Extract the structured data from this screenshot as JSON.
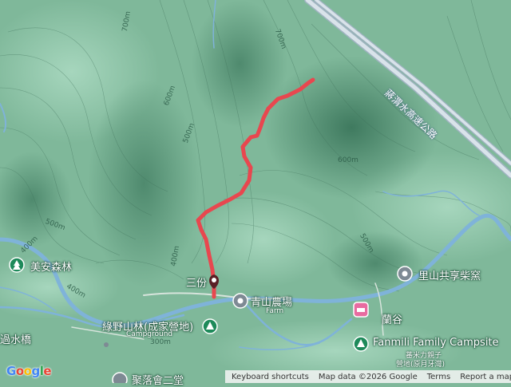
{
  "map": {
    "highway_label": "蔣渭水高速公路",
    "places": {
      "sanfen": "三份",
      "qingshan_farm": "青山農場",
      "qingshan_farm_sub": "Farm",
      "lvye_forest": "綠野山林(成家營地)",
      "lvye_forest_sub": "Campground",
      "meian_forest": "美安森林",
      "lishan_kiln": "里山共享柴窯",
      "langu": "蘭谷",
      "fanmili": "Fanmili Family Campsite",
      "fanmili_sub_1": "蕃米力親子",
      "fanmili_sub_2": "營地(原月牙灣)",
      "bridge": "過水橋",
      "bottom_partial": "聚落會二堂"
    },
    "contours": {
      "c1": "700m",
      "c2": "700m",
      "c3": "600m",
      "c4": "500m",
      "c5": "600m",
      "c6": "500m",
      "c7": "400m",
      "c8": "400m",
      "c9": "300m",
      "c10": "500m",
      "c11": "400m"
    }
  },
  "attribution": {
    "logo": "Google",
    "keyboard": "Keyboard shortcuts",
    "data": "Map data ©2026 Google",
    "terms": "Terms",
    "report": "Report a map error"
  },
  "colors": {
    "track": "#e8474f",
    "terrain": "#7fb89a",
    "river": "#7fb3d9",
    "highway": "#c8d4dc",
    "poi_gray": "#7e8a94",
    "poi_green": "#1e8a5a",
    "poi_pink": "#e86ca0"
  }
}
